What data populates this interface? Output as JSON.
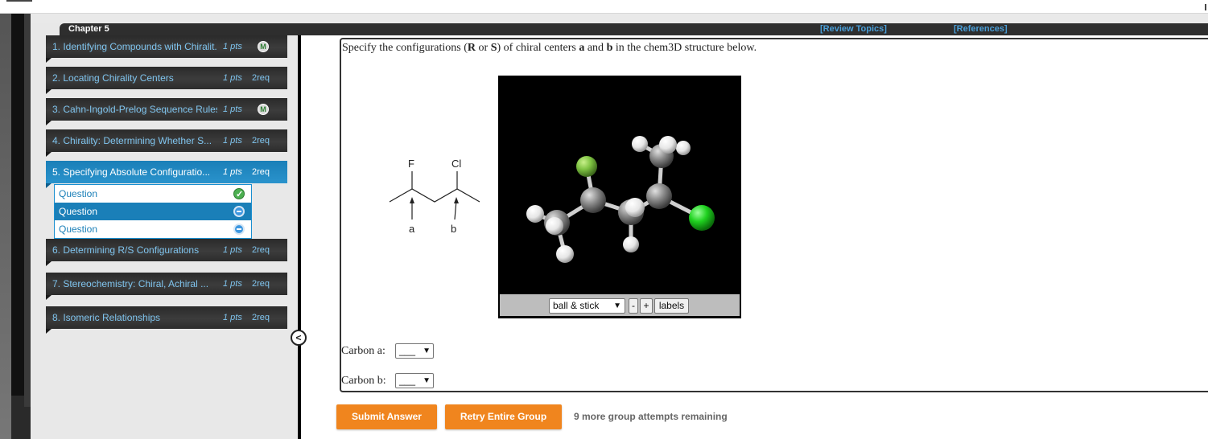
{
  "header": {
    "chapter": "Chapter 5",
    "review_topics": "[Review Topics]",
    "references": "[References]"
  },
  "sidebar": {
    "items": [
      {
        "title": "1. Identifying Compounds with Chiralit...",
        "pts": "1 pts",
        "badge": "M"
      },
      {
        "title": "2. Locating Chirality Centers",
        "pts": "1 pts",
        "req": "2req"
      },
      {
        "title": "3. Cahn-Ingold-Prelog Sequence Rules",
        "pts": "1 pts",
        "badge": "M"
      },
      {
        "title": "4. Chirality: Determining Whether S...",
        "pts": "1 pts",
        "req": "2req"
      },
      {
        "title": "5. Specifying Absolute Configuratio...",
        "pts": "1 pts",
        "req": "2req"
      },
      {
        "title": "6. Determining R/S Configurations",
        "pts": "1 pts",
        "req": "2req"
      },
      {
        "title": "7. Stereochemistry: Chiral, Achiral ...",
        "pts": "1 pts",
        "req": "2req"
      },
      {
        "title": "8. Isomeric Relationships",
        "pts": "1 pts",
        "req": "2req"
      }
    ],
    "sub_questions": [
      {
        "label": "Question",
        "status": "correct"
      },
      {
        "label": "Question",
        "status": "open"
      },
      {
        "label": "Question",
        "status": "open"
      }
    ],
    "collapse_label": "<"
  },
  "question": {
    "text_1": "Specify the configurations (",
    "R": "R",
    "text_or": " or ",
    "S": "S",
    "text_2": ") of chiral centers ",
    "a": "a",
    "text_and": " and ",
    "b": "b",
    "text_3": " in the chem3D structure below."
  },
  "structure2d": {
    "label_F": "F",
    "label_Cl": "Cl",
    "label_a": "a",
    "label_b": "b"
  },
  "viewer": {
    "mode": "ball & stick",
    "minus": "-",
    "plus": "+",
    "labels": "labels",
    "colors": {
      "background": "#000000",
      "carbon": "#8a8a8a",
      "hydrogen": "#ffffff",
      "fluorine": "#7ec242",
      "chlorine": "#1fd11f"
    }
  },
  "answers": {
    "carbon_a_label": "Carbon a",
    "carbon_b_label": "Carbon b",
    "placeholder": "___"
  },
  "actions": {
    "submit": "Submit Answer",
    "retry": "Retry Entire Group",
    "attempts": "9 more group attempts remaining"
  },
  "colors": {
    "accent": "#1a7fb8",
    "button": "#f0851e",
    "link": "#4a9fd8"
  }
}
